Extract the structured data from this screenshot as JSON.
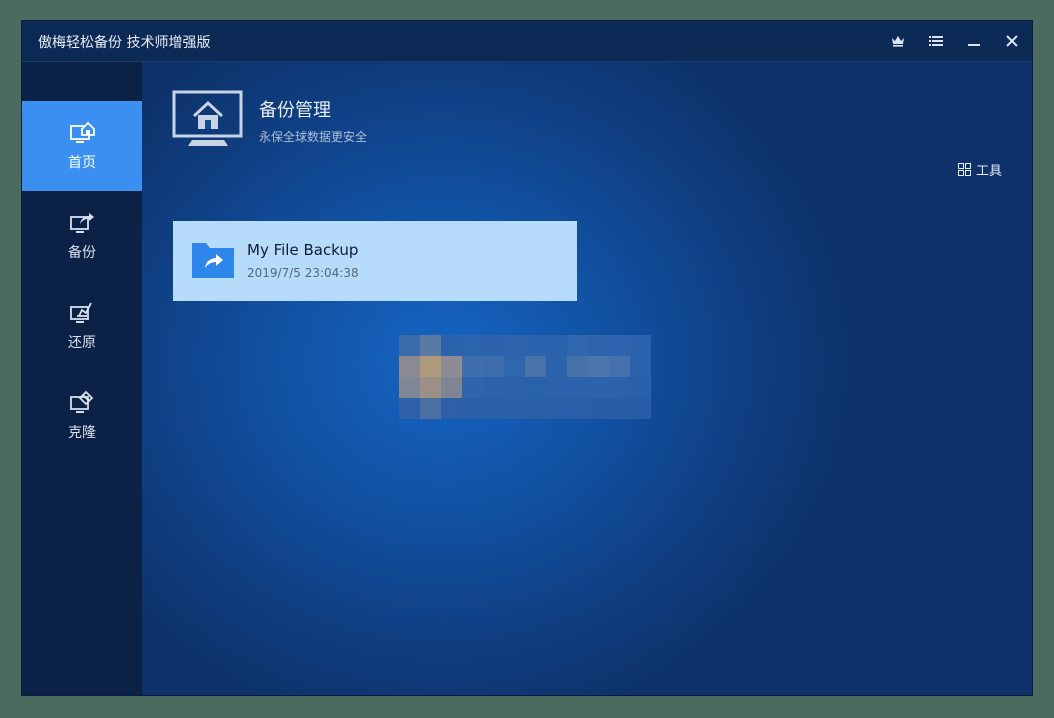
{
  "app": {
    "title": "傲梅轻松备份 技术师增强版"
  },
  "titlebar": {
    "buttons": [
      {
        "name": "upgrade-crown-icon"
      },
      {
        "name": "menu-icon"
      },
      {
        "name": "minimize-icon"
      },
      {
        "name": "close-icon"
      }
    ]
  },
  "sidebar": {
    "items": [
      {
        "label": "首页",
        "icon": "home-monitor-icon",
        "active": true
      },
      {
        "label": "备份",
        "icon": "backup-arrow-icon",
        "active": false
      },
      {
        "label": "还原",
        "icon": "restore-icon",
        "active": false
      },
      {
        "label": "克隆",
        "icon": "clone-icon",
        "active": false
      }
    ]
  },
  "header": {
    "title": "备份管理",
    "subtitle": "永保全球数据更安全"
  },
  "tools": {
    "label": "工具",
    "icon": "grid-icon"
  },
  "backups": [
    {
      "title": "My File Backup",
      "date": "2019/7/5 23:04:38",
      "icon": "folder-share-icon"
    }
  ],
  "colors": {
    "accent": "#3a8ff0",
    "card_bg": "#b7dcfb",
    "sidebar_bg": "#0b2146"
  }
}
